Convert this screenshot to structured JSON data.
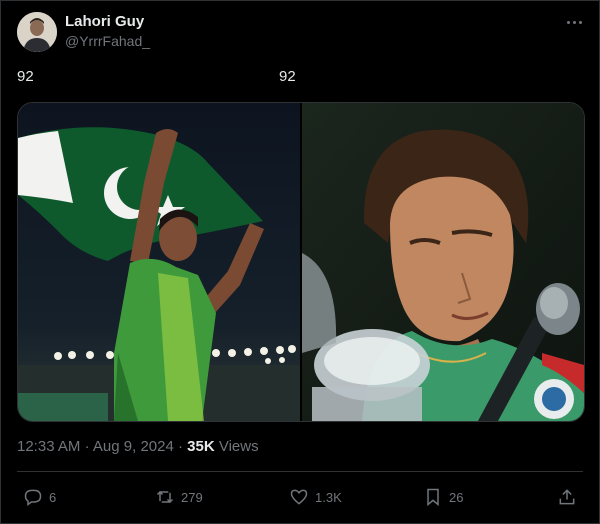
{
  "author": {
    "name": "Lahori Guy",
    "handle": "@YrrrFahad_"
  },
  "tweet": {
    "text_left": "92",
    "text_right": "92"
  },
  "meta": {
    "time": "12:33 AM",
    "dot1": "·",
    "date": "Aug 9, 2024",
    "dot2": "·",
    "views_count": "35K",
    "views_label": "Views"
  },
  "actions": {
    "replies": "6",
    "reposts": "279",
    "likes": "1.3K",
    "bookmarks": "26"
  },
  "icons": {
    "more": "more-horizontal-icon",
    "reply": "reply-icon",
    "repost": "repost-icon",
    "like": "heart-icon",
    "bookmark": "bookmark-icon",
    "share": "share-icon"
  },
  "colors": {
    "background": "#000000",
    "text": "#e7e9ea",
    "secondary": "#71767b",
    "border": "#2f3336",
    "flag_green": "#01411c"
  }
}
